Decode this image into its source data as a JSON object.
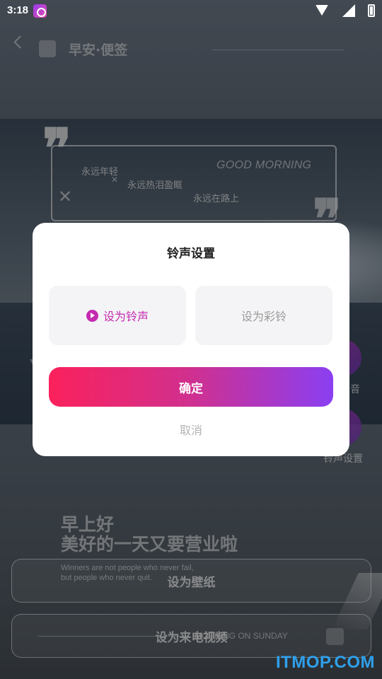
{
  "status_bar": {
    "time": "3:18"
  },
  "header": {
    "title": "早安·便签"
  },
  "quote_card": {
    "lines": [
      "永远年轻",
      "永远热泪盈眶",
      "永远在路上"
    ],
    "english": "GOOD MORNING",
    "quote_mark": "❞"
  },
  "side_buttons": {
    "label_1": "音",
    "label_2": "铃声设置"
  },
  "wallpaper": {
    "line_1": "早上好",
    "line_2": "美好的一天又要营业啦",
    "winners_1": "Winners are not people who never fail,",
    "winners_2": "but people who never quit.",
    "sunday": "MORNING ON SUNDAY"
  },
  "bottom_buttons": {
    "set_wallpaper": "设为壁纸",
    "set_call_video": "设为来电视频"
  },
  "dialog": {
    "title": "铃声设置",
    "option_ringtone": "设为铃声",
    "option_crbt": "设为彩铃",
    "confirm": "确定",
    "cancel": "取消",
    "selected": "设为铃声"
  },
  "watermark": "ITMOP.COM",
  "colors": {
    "accent": "#c42bb0",
    "gradient_start": "#fb215c",
    "gradient_end": "#8a3ff2",
    "watermark": "#2fa0ea"
  }
}
